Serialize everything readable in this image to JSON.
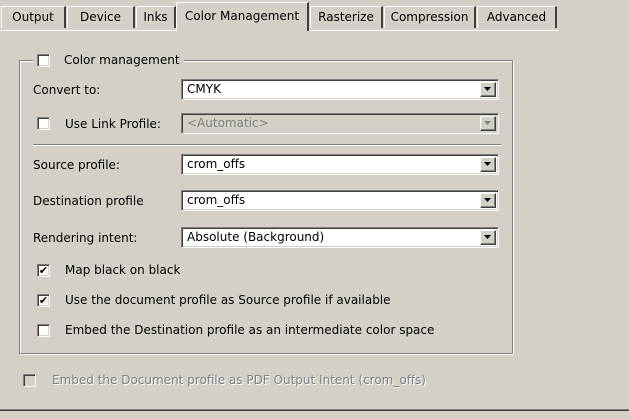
{
  "tabs": [
    {
      "label": "Output",
      "active": false
    },
    {
      "label": "Device",
      "active": false
    },
    {
      "label": "Inks",
      "active": false
    },
    {
      "label": "Color Management",
      "active": true
    },
    {
      "label": "Rasterize",
      "active": false
    },
    {
      "label": "Compression",
      "active": false
    },
    {
      "label": "Advanced",
      "active": false
    }
  ],
  "group": {
    "legend_label": "Color management",
    "legend_checked": false
  },
  "convert_to": {
    "label": "Convert to:",
    "value": "CMYK"
  },
  "link_profile": {
    "label": "Use Link Profile:",
    "checked": false,
    "value": "<Automatic>",
    "enabled": false
  },
  "source_profile": {
    "label": "Source profile:",
    "value": "crom_offs"
  },
  "destination_profile": {
    "label": "Destination profile",
    "value": "crom_offs"
  },
  "rendering_intent": {
    "label": "Rendering intent:",
    "value": "Absolute (Background)"
  },
  "options": [
    {
      "label": "Map black on black",
      "checked": true
    },
    {
      "label": "Use the document profile as Source profile if available",
      "checked": true
    },
    {
      "label": "Embed the Destination profile as an intermediate color space",
      "checked": false
    }
  ],
  "pdf_intent": {
    "label": "Embed the Document profile as PDF Output Intent (crom_offs)",
    "checked": false,
    "enabled": false
  },
  "check_glyph": "✔",
  "colors": {
    "background": "#d4d0c8",
    "disabled_text": "#808080"
  }
}
